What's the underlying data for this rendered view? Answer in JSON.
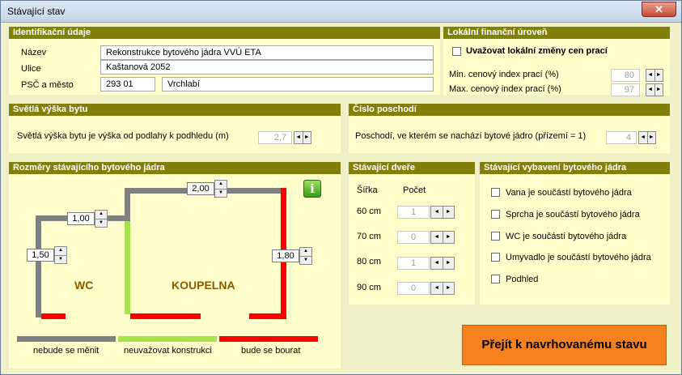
{
  "window": {
    "title": "Stávající stav",
    "close": "✕"
  },
  "ident": {
    "header": "Identifikační údaje",
    "nazev_label": "Název",
    "nazev_value": "Rekonstrukce bytového jádra VVÚ ETA",
    "ulice_label": "Ulice",
    "ulice_value": "Kaštanová 2052",
    "psc_label": "PSČ a město",
    "psc_value": "293 01",
    "mesto_value": "Vrchlabí"
  },
  "lokal": {
    "header": "Lokální finanční úroveň",
    "checkbox_label": "Uvažovat lokální změny cen prací",
    "min_label": "Min. cenový index prací (%)",
    "min_value": "80",
    "max_label": "Max. cenový index prací (%)",
    "max_value": "97"
  },
  "vyska": {
    "header": "Světlá výška bytu",
    "label": "Světlá výška bytu je výška od podlahy k podhledu (m)",
    "value": "2,7"
  },
  "poschodi": {
    "header": "Číslo poschodí",
    "label": "Poschodí, ve kterém se nachází bytové jádro (přízemí = 1)",
    "value": "4"
  },
  "rozmery": {
    "header": "Rozměry stávajícího bytového jádra",
    "top_dim": "2,00",
    "mid_dim": "1,00",
    "left_dim": "1,50",
    "right_dim": "1,80",
    "wc": "WC",
    "koupelna": "KOUPELNA",
    "info": "i",
    "legend": [
      {
        "label": "nebude se měnit",
        "color": "#808080"
      },
      {
        "label": "neuvažovat konstrukci",
        "color": "#a6e34a"
      },
      {
        "label": "bude se bourat",
        "color": "#ff0000"
      }
    ]
  },
  "dvere": {
    "header": "Stávající dveře",
    "col_sirka": "Šířka",
    "col_pocet": "Počet",
    "rows": [
      {
        "width": "60 cm",
        "count": "1"
      },
      {
        "width": "70 cm",
        "count": "0"
      },
      {
        "width": "80 cm",
        "count": "1"
      },
      {
        "width": "90 cm",
        "count": "0"
      }
    ]
  },
  "vybaveni": {
    "header": "Stávající vybavení bytového jádra",
    "items": [
      "Vana je součástí bytového jádra",
      "Sprcha je součástí bytového jádra",
      "WC je součástí bytového jádra",
      "Umyvadlo  je součástí bytového jádra",
      "Podhled"
    ]
  },
  "action": {
    "label": "Přejít k navrhovanému stavu"
  },
  "icons": {
    "left": "◄",
    "right": "►",
    "up": "▲",
    "down": "▼"
  }
}
